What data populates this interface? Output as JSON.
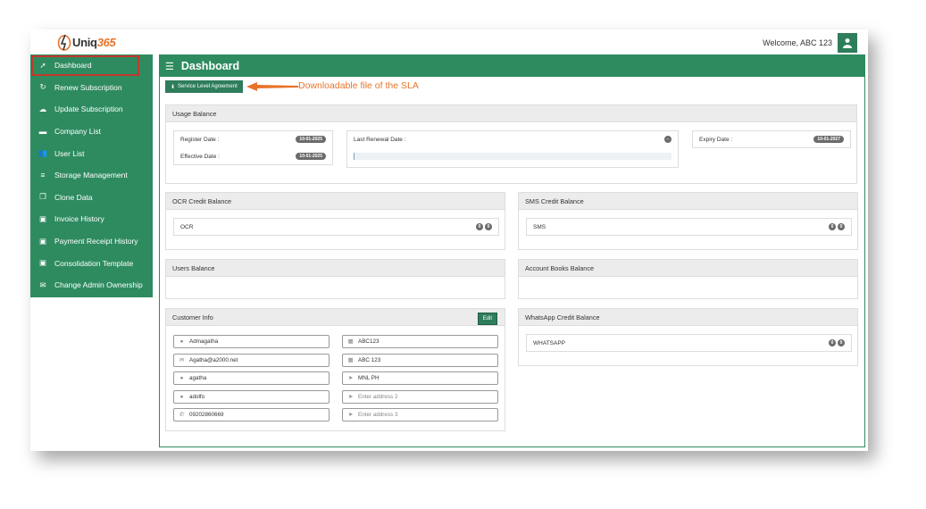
{
  "brand": {
    "logo_prefix": "Uniq",
    "logo_suffix": "365"
  },
  "topbar": {
    "welcome": "Welcome, ABC 123"
  },
  "sidebar": {
    "items": [
      {
        "label": "Dashboard",
        "icon": "rocket-icon"
      },
      {
        "label": "Renew Subscription",
        "icon": "refresh-icon"
      },
      {
        "label": "Update Subscription",
        "icon": "cloud-upload-icon"
      },
      {
        "label": "Company List",
        "icon": "briefcase-icon"
      },
      {
        "label": "User List",
        "icon": "users-icon"
      },
      {
        "label": "Storage Management",
        "icon": "database-icon"
      },
      {
        "label": "Clone Data",
        "icon": "copy-icon"
      },
      {
        "label": "Invoice History",
        "icon": "money-icon"
      },
      {
        "label": "Payment Receipt History",
        "icon": "money-icon"
      },
      {
        "label": "Consolidation Template",
        "icon": "money-icon"
      },
      {
        "label": "Change Admin Ownership",
        "icon": "envelope-icon"
      }
    ]
  },
  "header": {
    "title": "Dashboard"
  },
  "sla": {
    "button_label": "Service Level Agreement",
    "annotation": "Downloadable file of the SLA"
  },
  "usage": {
    "title": "Usage Balance",
    "register_label": "Register Date :",
    "register_value": "10-01-2025",
    "effective_label": "Effective Date :",
    "effective_value": "10-01-2025",
    "renewal_label": "Last Renewal Date :",
    "renewal_value": "-",
    "expiry_label": "Expiry Date :",
    "expiry_value": "10-01-2027"
  },
  "ocr": {
    "title": "OCR Credit Balance",
    "label": "OCR",
    "a": "0",
    "b": "0"
  },
  "sms": {
    "title": "SMS Credit Balance",
    "label": "SMS",
    "a": "0",
    "b": "0"
  },
  "users_balance": {
    "title": "Users Balance"
  },
  "books_balance": {
    "title": "Account Books Balance"
  },
  "whatsapp": {
    "title": "WhatsApp Credit Balance",
    "label": "WHATSAPP",
    "a": "0",
    "b": "0"
  },
  "customer": {
    "title": "Customer Info",
    "edit_label": "Edit",
    "left": [
      {
        "value": "Admagatha",
        "icon": "user-icon"
      },
      {
        "value": "Agatha@a2000.net",
        "icon": "envelope-icon"
      },
      {
        "value": "agatha",
        "icon": "user-icon"
      },
      {
        "value": "adolfo",
        "icon": "user-icon"
      },
      {
        "value": "09202860669",
        "icon": "phone-icon"
      }
    ],
    "right": [
      {
        "value": "ABC123",
        "icon": "building-icon"
      },
      {
        "value": "ABC 123",
        "icon": "building-icon"
      },
      {
        "value": "MNL PH",
        "icon": "location-arrow-icon"
      }
    ],
    "address2_placeholder": "Enter address 2",
    "address3_placeholder": "Enter address 3"
  }
}
